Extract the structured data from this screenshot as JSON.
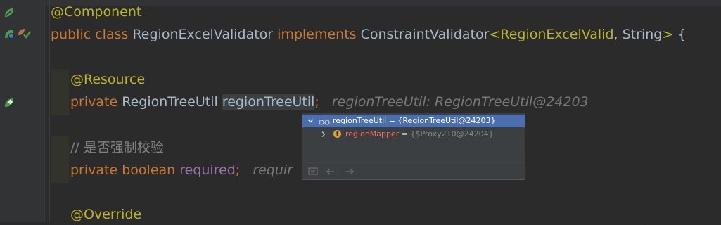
{
  "code": {
    "line1": {
      "annotation": "@Component"
    },
    "line2": {
      "kw_public": "public",
      "kw_class": "class",
      "class_name": "RegionExcelValidator",
      "kw_implements": "implements",
      "iface": "ConstraintValidator",
      "lt": "<",
      "gen_type": "RegionExcelValid",
      "comma_string": ", String",
      "gt": ">",
      "tail": " {"
    },
    "line3": {
      "annotation": "@Resource"
    },
    "line4": {
      "kw": "private",
      "type": "RegionTreeUtil",
      "field": "regionTreeUtil",
      "semi": ";",
      "hint": "regionTreeUtil: RegionTreeUtil@24203"
    },
    "line5": {
      "comment": "// 是否强制校验"
    },
    "line6": {
      "kw": "private",
      "kw_type": "boolean",
      "field": "required",
      "semi": ";",
      "hint": "requir"
    },
    "line7": {
      "annotation": "@Override"
    }
  },
  "popup": {
    "row1": {
      "name": "regionTreeUtil",
      "eq": " = ",
      "value": "{RegionTreeUtil@24203}"
    },
    "row2": {
      "badge": "f",
      "name": "regionMapper",
      "eq": " = ",
      "value": "{$Proxy210@24204}"
    }
  },
  "colors": {
    "background": "#2b2b2b",
    "keyword": "#cc7832",
    "annotation": "#bbb529",
    "field": "#9876aa",
    "selection": "#4b6eaf"
  },
  "icons": [
    "spring-bean-icon",
    "spring-bean-search-icon",
    "bean-link-icon",
    "navigate-arrow-icon",
    "glasses-icon",
    "pin-icon",
    "back-arrow-icon",
    "forward-arrow-icon"
  ]
}
